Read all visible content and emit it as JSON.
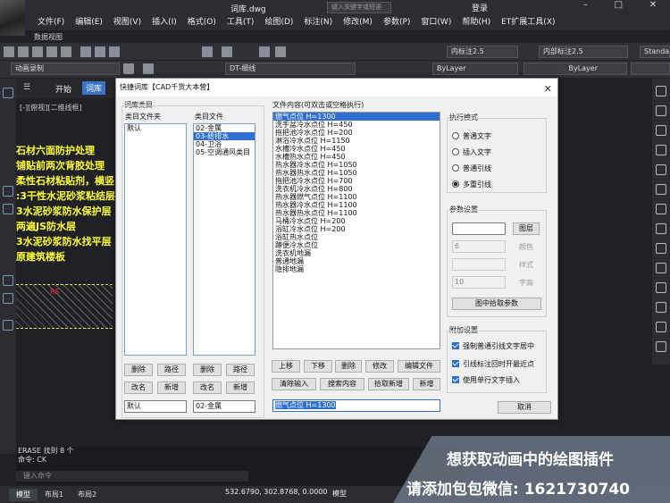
{
  "app": {
    "filename": "词库.dwg",
    "search_placeholder": "键入关键字或短语",
    "login": "登录",
    "menus": [
      "文件(F)",
      "编辑(E)",
      "视图(V)",
      "插入(I)",
      "格式(O)",
      "工具(T)",
      "绘图(D)",
      "标注(N)",
      "修改(M)",
      "参数(P)",
      "窗口(W)",
      "帮助(H)",
      "ET扩展工具(X)"
    ],
    "ribbon_label": "数据视图",
    "toolbar": {
      "recorder": "动画录制",
      "layer": "DT-细线",
      "color": "ByLayer",
      "linetype": "ByLayer",
      "dim1": "内标注2.5",
      "dim2": "内部标注2.5",
      "style": "Standa"
    },
    "tabs": {
      "start": "开始",
      "current": "词库"
    },
    "view_label": "[-][俯视][二维线框]"
  },
  "canvas": {
    "lines": [
      "石材六面防护处理",
      "铺贴前两次背胶处理",
      "柔性石材粘贴剂，横竖",
      ":3干性水泥砂浆粘结层",
      "3水泥砂浆防水保护层",
      "两遍JS防水层",
      "3水泥砂浆防水找平层",
      "原建筑楼板"
    ],
    "marker": "RS"
  },
  "dialog": {
    "title": "快捷词库【CAD千货大本营】",
    "close": "✕",
    "lib_group": "词库类目",
    "folder_label": "类目文件夹",
    "file_label": "类目文件",
    "folders": [
      "默认"
    ],
    "files": [
      "02-金属",
      "03-给排水",
      "04-卫浴",
      "05-空调通风类目"
    ],
    "selected_file_index": 1,
    "left_buttons_row1": [
      "删除",
      "路径",
      "删除",
      "路径"
    ],
    "left_buttons_row2": [
      "改名",
      "新增",
      "改名",
      "新增"
    ],
    "folder_value": "默认",
    "file_value": "02-金属",
    "content_label": "文件内容(可双击或空格执行)",
    "content_items": [
      "燃气点位 H=1300",
      "洗手盆冷水点位 H=450",
      "拖把池冷水点位 H=200",
      "淋浴冷水点位 H=1150",
      "水槽冷水点位 H=450",
      "水槽热水点位 H=450",
      "热水器冷水点位 H=1050",
      "热水器热水点位 H=1050",
      "拖把池冷水点位 H=700",
      "洗衣机冷水点位 H=800",
      "热水器燃气点位 H=1100",
      "热水器冷水点位 H=1100",
      "热水器热水点位 H=1100",
      "马桶冷水点位 H=200",
      "浴缸冷水点位 H=200",
      "浴缸热水点位",
      "蹲便冷水点位",
      "洗衣机地漏",
      "普通地漏",
      "隐排地漏"
    ],
    "mid_buttons_row1": [
      "上移",
      "下移",
      "删除",
      "修改",
      "编辑文件"
    ],
    "mid_buttons_row2": [
      "清除输入",
      "搜索内容",
      "拾取新增",
      "新增"
    ],
    "content_value": "燃气点位 H=1300",
    "mode_group": "执行模式",
    "modes": [
      "普通文字",
      "插入文字",
      "普通引线",
      "多重引线"
    ],
    "selected_mode": 3,
    "param_group": "参数设置",
    "param_layer_btn": "图层",
    "param_color_value": "6",
    "param_color_btn": "颜色",
    "param_style_btn": "样式",
    "param_height_value": "10",
    "param_height_btn": "字高",
    "pick_param_btn": "图中拾取参数",
    "extra_group": "附加设置",
    "extras": [
      "强制普通引线文字居中",
      "引线标注回时开最近点",
      "使用单行文字插入"
    ],
    "cancel": "取消"
  },
  "command": {
    "lines": [
      "ERASE 找到 8 个",
      "命令: CK"
    ],
    "input_placeholder": "键入命令"
  },
  "statusbar": {
    "tabs": [
      "模型",
      "布局1",
      "布局2"
    ],
    "coords": "532.6790, 302.8768, 0.0000",
    "mode": "模型"
  },
  "banner": {
    "line1": "想获取动画中的绘图插件",
    "line2": "请添加包包微信: 1621730740"
  }
}
